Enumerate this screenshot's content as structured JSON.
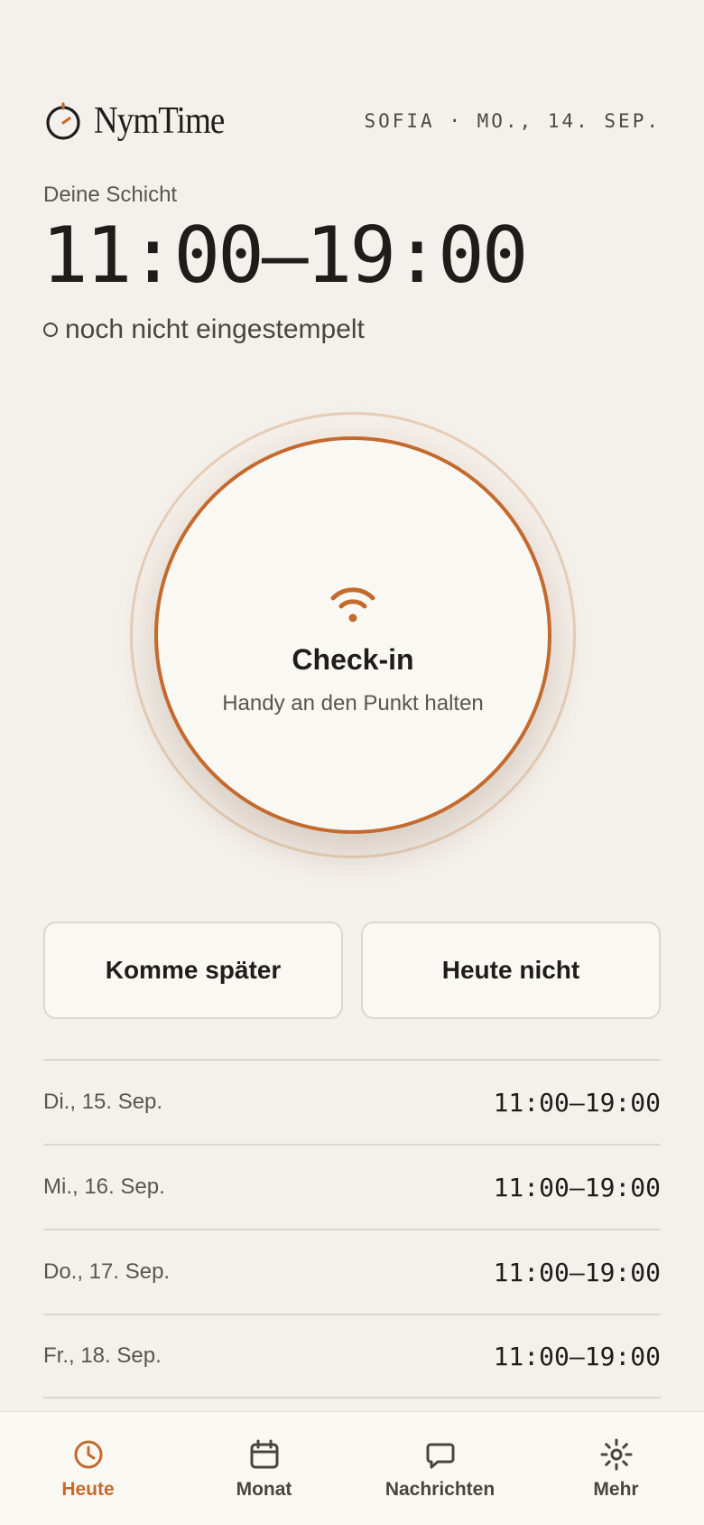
{
  "app": {
    "name": "NymTime",
    "location_date": "SOFIA · MO., 14. SEP."
  },
  "shift": {
    "label": "Deine Schicht",
    "time": "11:00–19:00",
    "status": "noch nicht eingestempelt"
  },
  "checkin": {
    "title": "Check-in",
    "subtitle": "Handy an den Punkt halten"
  },
  "actions": {
    "late": "Komme später",
    "not_today": "Heute nicht"
  },
  "upcoming": [
    {
      "date": "Di., 15. Sep.",
      "time": "11:00–19:00"
    },
    {
      "date": "Mi., 16. Sep.",
      "time": "11:00–19:00"
    },
    {
      "date": "Do., 17. Sep.",
      "time": "11:00–19:00"
    },
    {
      "date": "Fr., 18. Sep.",
      "time": "11:00–19:00"
    }
  ],
  "nav": [
    {
      "label": "Heute",
      "icon": "clock-icon",
      "active": true
    },
    {
      "label": "Monat",
      "icon": "calendar-icon",
      "active": false
    },
    {
      "label": "Nachrichten",
      "icon": "chat-icon",
      "active": false
    },
    {
      "label": "Mehr",
      "icon": "gear-icon",
      "active": false
    }
  ],
  "colors": {
    "accent": "#c46a2e",
    "background": "#f4f1ec",
    "surface": "#faf8f3",
    "text": "#1f1d1a"
  }
}
